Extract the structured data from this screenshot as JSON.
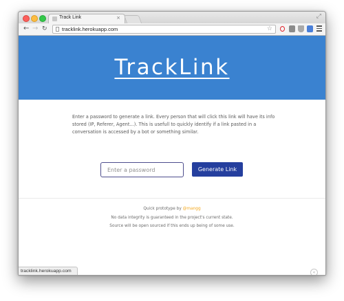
{
  "browser": {
    "tab_title": "Track Link",
    "tab_close": "×",
    "url": "tracklink.herokuapp.com",
    "status_text": "tracklink.herokuapp.com"
  },
  "page": {
    "brand": "TrackLink",
    "intro": "Enter a password to generate a link. Every person that will click this link will have its info stored (IP, Referer, Agent...). This is usefull to quickly identify if a link pasted in a conversation is accessed by a bot or something similar.",
    "password_placeholder": "Enter a password",
    "generate_label": "Generate Link",
    "footer": {
      "prototype_prefix": "Quick prototype by ",
      "author_link": "@mangg",
      "line2": "No data integrity is guaranteed in the project's current state.",
      "line3": "Source will be open sourced if this ends up being of some use."
    }
  },
  "colors": {
    "hero": "#3a82d0",
    "button": "#253f9e",
    "link": "#f3a81e"
  }
}
